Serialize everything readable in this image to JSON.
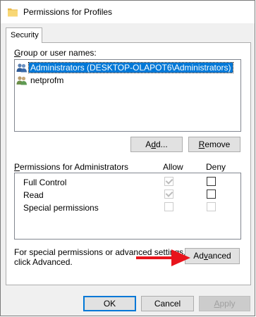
{
  "window": {
    "title": "Permissions for Profiles"
  },
  "tabs": [
    {
      "label": "Security"
    }
  ],
  "group_section": {
    "label_prefix": "",
    "label_accel": "G",
    "label_rest": "roup or user names:",
    "items": [
      {
        "name": "Administrators (DESKTOP-OLAPOT6\\Administrators)",
        "selected": true,
        "icon": "users-group-icon"
      },
      {
        "name": "netprofm",
        "selected": false,
        "icon": "user-icon"
      }
    ]
  },
  "buttons": {
    "add": {
      "before": "A",
      "accel": "d",
      "after": "d..."
    },
    "remove": {
      "before": "",
      "accel": "R",
      "after": "emove"
    },
    "advanced": {
      "before": "Ad",
      "accel": "v",
      "after": "anced"
    },
    "ok": "OK",
    "cancel": "Cancel",
    "apply": {
      "before": "",
      "accel": "A",
      "after": "pply"
    }
  },
  "permissions": {
    "label_prefix": "",
    "label_accel": "P",
    "label_rest": "ermissions for Administrators",
    "allow_header": "Allow",
    "deny_header": "Deny",
    "rows": [
      {
        "name": "Full Control",
        "allow": "checked-disabled",
        "deny": "unchecked"
      },
      {
        "name": "Read",
        "allow": "checked-disabled",
        "deny": "unchecked"
      },
      {
        "name": "Special permissions",
        "allow": "disabled",
        "deny": "disabled"
      }
    ]
  },
  "advanced_info": {
    "line1": "For special permissions or advanced settings,",
    "line2": "click Advanced."
  },
  "colors": {
    "selection": "#0078d7",
    "arrow": "#e8141c"
  }
}
